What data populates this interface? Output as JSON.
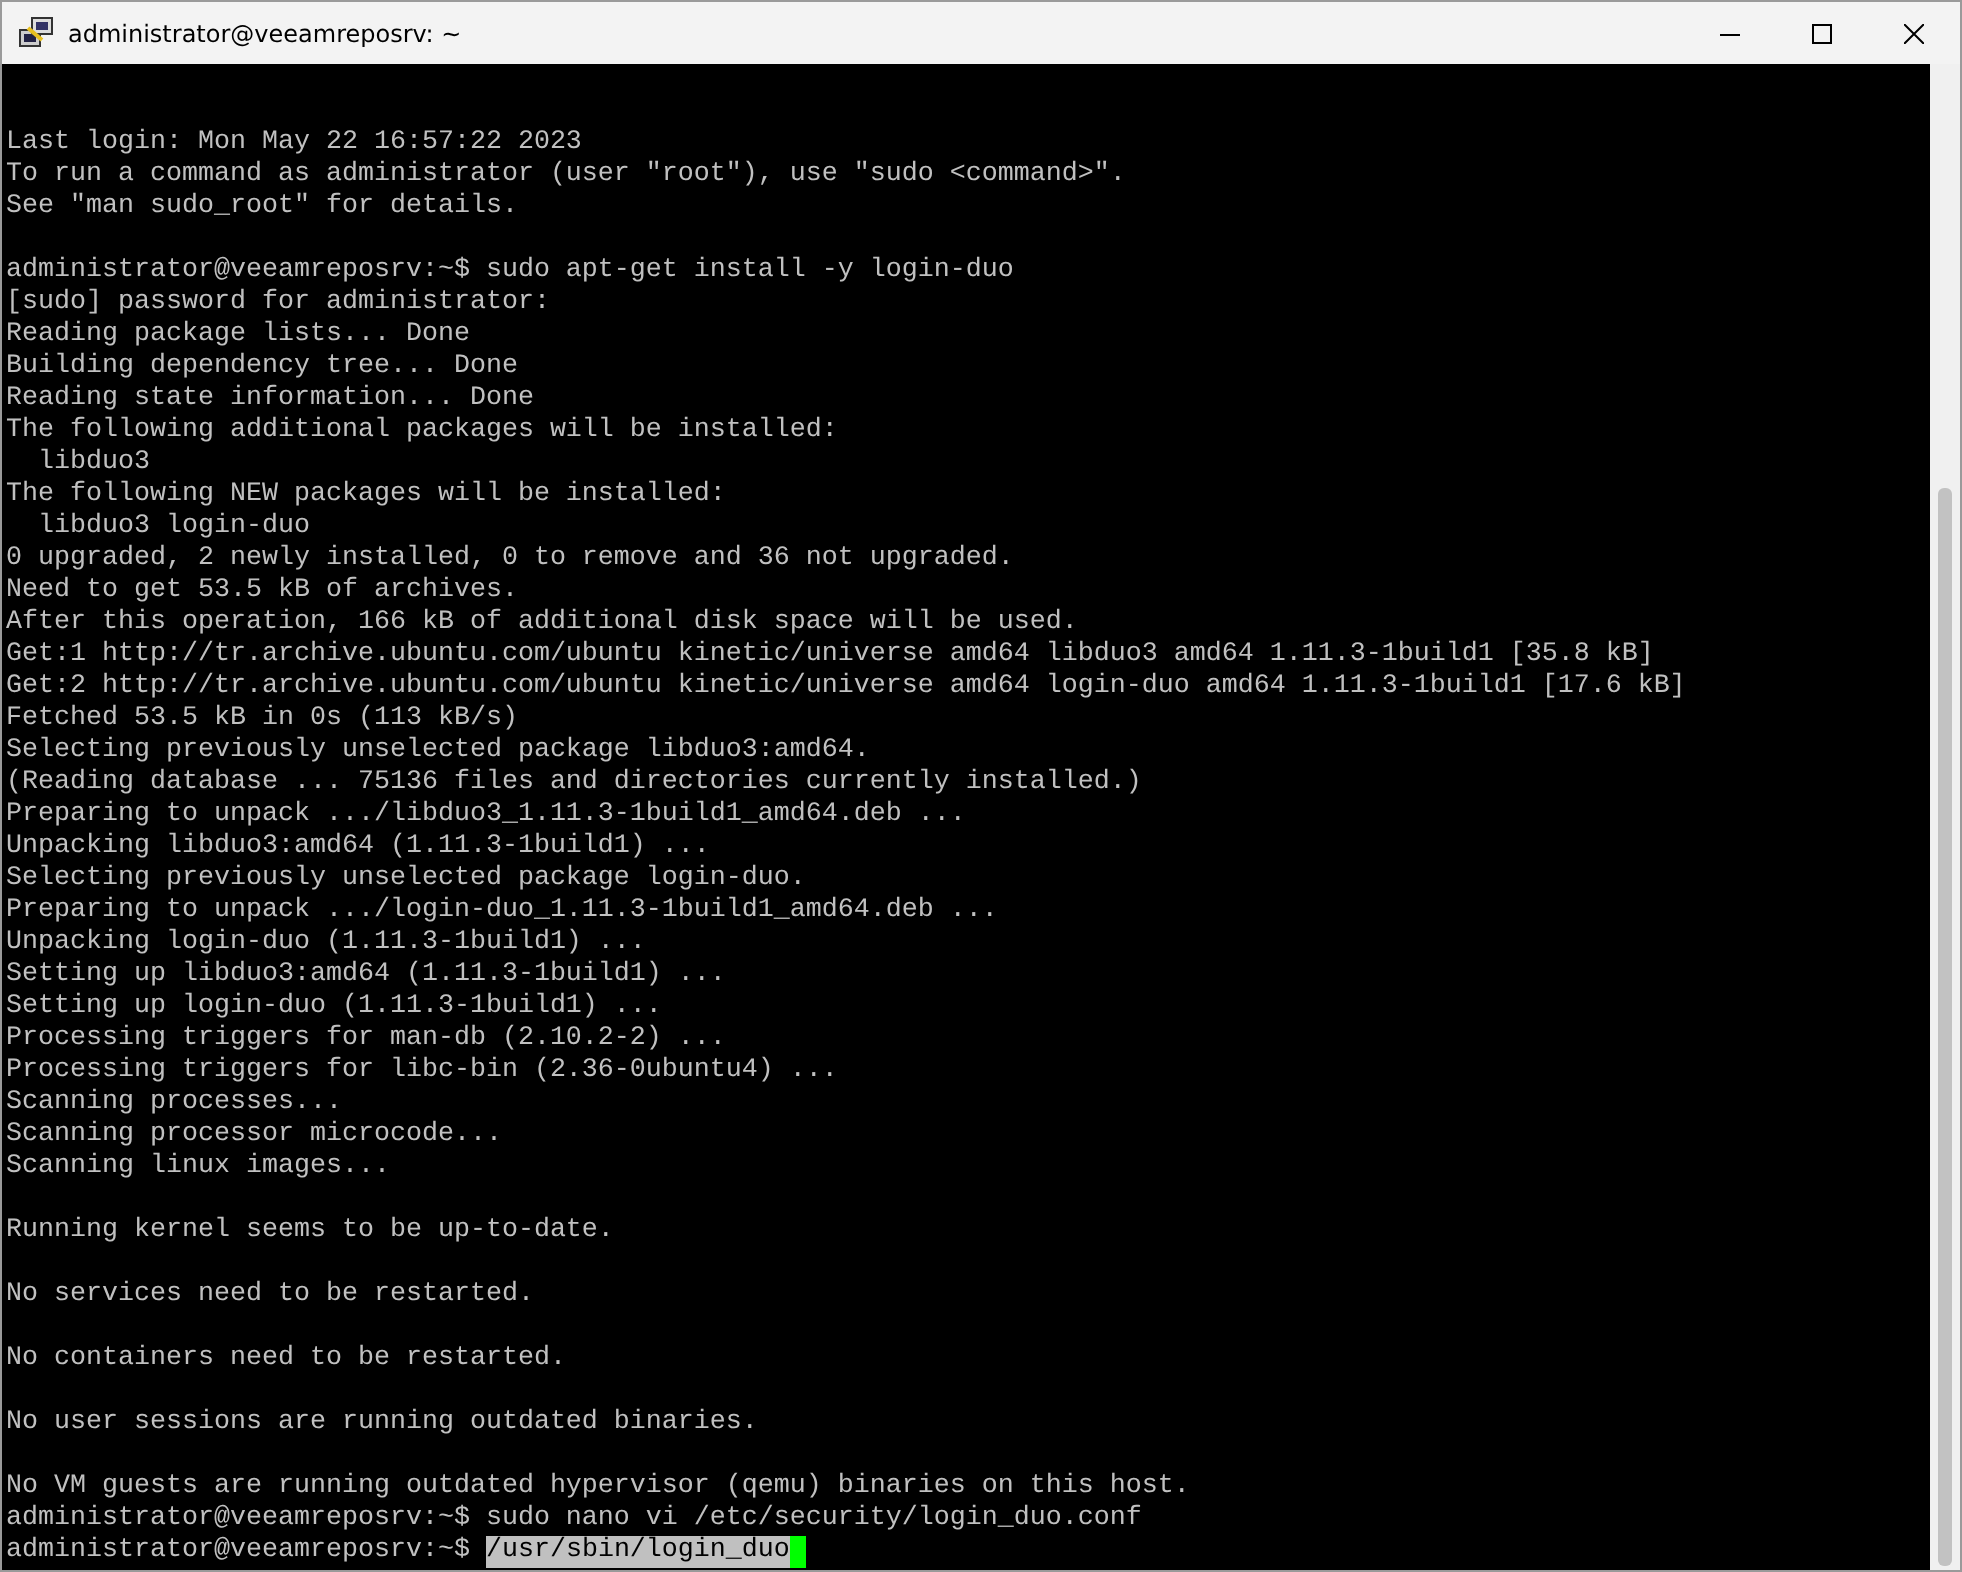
{
  "window": {
    "title": "administrator@veeamreposrv: ~"
  },
  "terminal": {
    "blocks": [
      {
        "lines": [
          "Last login: Mon May 22 16:57:22 2023",
          "To run a command as administrator (user \"root\"), use \"sudo <command>\".",
          "See \"man sudo_root\" for details."
        ]
      },
      {
        "lines": [
          "administrator@veeamreposrv:~$ sudo apt-get install -y login-duo",
          "[sudo] password for administrator:",
          "Reading package lists... Done",
          "Building dependency tree... Done",
          "Reading state information... Done",
          "The following additional packages will be installed:",
          "  libduo3",
          "The following NEW packages will be installed:",
          "  libduo3 login-duo",
          "0 upgraded, 2 newly installed, 0 to remove and 36 not upgraded.",
          "Need to get 53.5 kB of archives.",
          "After this operation, 166 kB of additional disk space will be used.",
          "Get:1 http://tr.archive.ubuntu.com/ubuntu kinetic/universe amd64 libduo3 amd64 1.11.3-1build1 [35.8 kB]",
          "Get:2 http://tr.archive.ubuntu.com/ubuntu kinetic/universe amd64 login-duo amd64 1.11.3-1build1 [17.6 kB]",
          "Fetched 53.5 kB in 0s (113 kB/s)",
          "Selecting previously unselected package libduo3:amd64.",
          "(Reading database ... 75136 files and directories currently installed.)",
          "Preparing to unpack .../libduo3_1.11.3-1build1_amd64.deb ...",
          "Unpacking libduo3:amd64 (1.11.3-1build1) ...",
          "Selecting previously unselected package login-duo.",
          "Preparing to unpack .../login-duo_1.11.3-1build1_amd64.deb ...",
          "Unpacking login-duo (1.11.3-1build1) ...",
          "Setting up libduo3:amd64 (1.11.3-1build1) ...",
          "Setting up login-duo (1.11.3-1build1) ...",
          "Processing triggers for man-db (2.10.2-2) ...",
          "Processing triggers for libc-bin (2.36-0ubuntu4) ...",
          "Scanning processes...",
          "Scanning processor microcode...",
          "Scanning linux images..."
        ]
      },
      {
        "lines": [
          "Running kernel seems to be up-to-date."
        ]
      },
      {
        "lines": [
          "No services need to be restarted."
        ]
      },
      {
        "lines": [
          "No containers need to be restarted."
        ]
      },
      {
        "lines": [
          "No user sessions are running outdated binaries."
        ]
      },
      {
        "lines": [
          "No VM guests are running outdated hypervisor (qemu) binaries on this host.",
          "administrator@veeamreposrv:~$ sudo nano vi /etc/security/login_duo.conf"
        ]
      }
    ],
    "input_line": {
      "prompt": "administrator@veeamreposrv:~$ ",
      "selected_text": "/usr/sbin/login_duo",
      "cursor": true
    }
  }
}
